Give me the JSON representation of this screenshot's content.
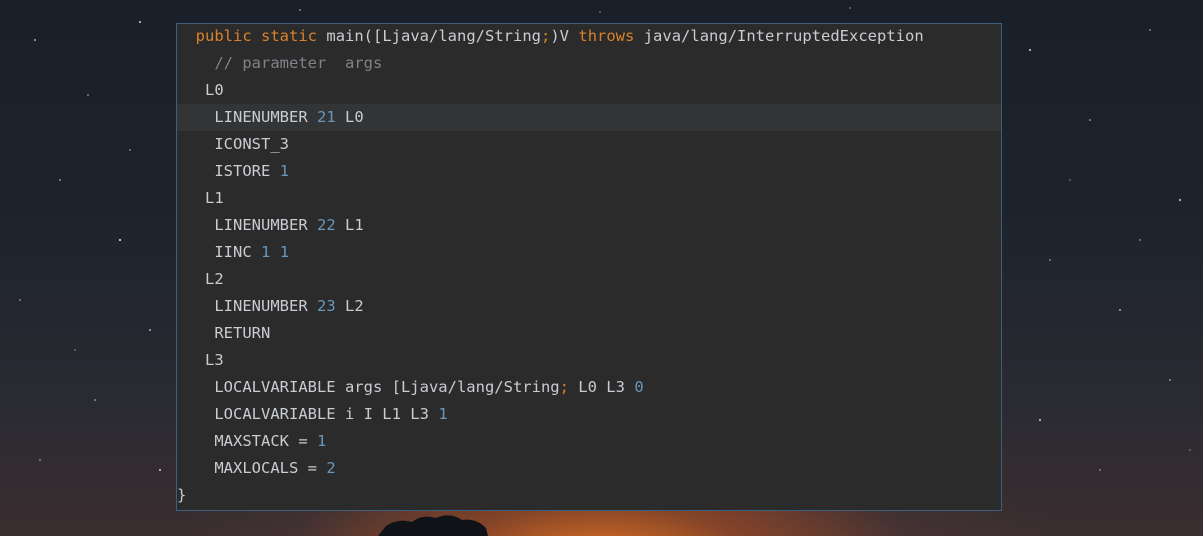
{
  "colors": {
    "editor_bg": "#2b2b2b",
    "keyword": "#d9822b",
    "number": "#6897bb",
    "comment": "#7f8389",
    "text": "#c9ccd1"
  },
  "code": {
    "l0_kw1": "public",
    "l0_kw2": "static",
    "l0_sig": "main([Ljava/lang/String",
    "l0_semi": ";",
    "l0_sig2": ")V",
    "l0_throws": "throws",
    "l0_exc": "java/lang/InterruptedException",
    "l1_comment": "// parameter  args",
    "l2": "L0",
    "l3_op": "LINENUMBER",
    "l3_num": "21",
    "l3_lbl": "L0",
    "l4": "ICONST_3",
    "l5_op": "ISTORE",
    "l5_num": "1",
    "l6": "L1",
    "l7_op": "LINENUMBER",
    "l7_num": "22",
    "l7_lbl": "L1",
    "l8_op": "IINC",
    "l8_num1": "1",
    "l8_num2": "1",
    "l9": "L2",
    "l10_op": "LINENUMBER",
    "l10_num": "23",
    "l10_lbl": "L2",
    "l11": "RETURN",
    "l12": "L3",
    "l13_op": "LOCALVARIABLE args [Ljava/lang/String",
    "l13_semi": ";",
    "l13_rest": "L0 L3",
    "l13_num": "0",
    "l14_op": "LOCALVARIABLE i I L1 L3",
    "l14_num": "1",
    "l15_op": "MAXSTACK =",
    "l15_num": "1",
    "l16_op": "MAXLOCALS =",
    "l16_num": "2",
    "l17": "}"
  }
}
